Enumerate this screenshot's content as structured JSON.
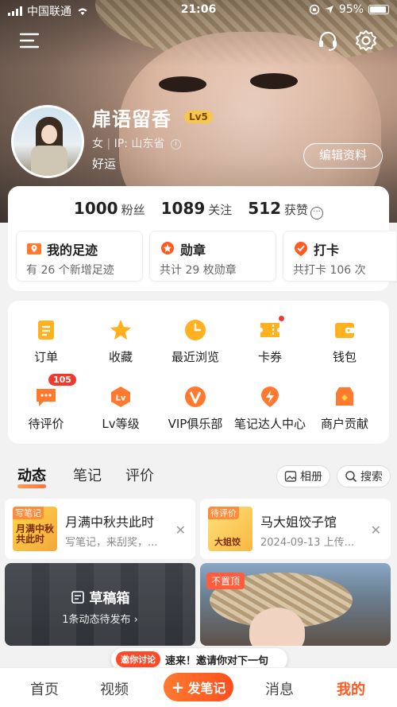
{
  "status_bar": {
    "carrier": "中国联通",
    "time": "21:06",
    "battery": "95%"
  },
  "profile": {
    "name": "扉语留香",
    "level": "Lv5",
    "gender": "女",
    "ip": "IP: 山东省",
    "bio": "好运",
    "edit_label": "编辑资料"
  },
  "stats": [
    {
      "num": "1000",
      "label": "粉丝"
    },
    {
      "num": "1089",
      "label": "关注"
    },
    {
      "num": "512",
      "label": "获赞"
    }
  ],
  "mini_cards": [
    {
      "title": "我的足迹",
      "sub": "有 26 个新增足迹",
      "icon": "map-pin-icon",
      "color": "#ff7a2f"
    },
    {
      "title": "勋章",
      "sub": "共计 29 枚勋章",
      "icon": "medal-icon",
      "color": "#ff5a1f"
    },
    {
      "title": "打卡",
      "sub": "共打卡 106 次",
      "icon": "checkin-icon",
      "color": "#ff5a1f"
    }
  ],
  "grid": [
    {
      "label": "订单",
      "icon": "order-icon"
    },
    {
      "label": "收藏",
      "icon": "star-icon"
    },
    {
      "label": "最近浏览",
      "icon": "clock-icon"
    },
    {
      "label": "卡券",
      "icon": "ticket-icon"
    },
    {
      "label": "钱包",
      "icon": "wallet-icon"
    },
    {
      "label": "待评价",
      "icon": "comment-icon",
      "badge": "105"
    },
    {
      "label": "Lv等级",
      "icon": "level-icon"
    },
    {
      "label": "VIP俱乐部",
      "icon": "vip-icon"
    },
    {
      "label": "笔记达人中心",
      "icon": "lightning-icon"
    },
    {
      "label": "商户贡献",
      "icon": "shop-icon"
    }
  ],
  "tabs": [
    "动态",
    "笔记",
    "评价"
  ],
  "tab_buttons": {
    "album": "相册",
    "search": "搜索"
  },
  "feed_cards": [
    {
      "tag": "写笔记",
      "thumb_text": "月满中秋共此时",
      "title": "月满中秋共此时",
      "sub": "写笔记，来刮奖，..."
    },
    {
      "tag": "待评价",
      "thumb_text": "大姐饺",
      "title": "马大姐饺子馆",
      "sub": "2024-09-13 上传..."
    }
  ],
  "drafts": {
    "title": "草稿箱",
    "sub": "1条动态待发布"
  },
  "photo_card": {
    "pin": "不置顶"
  },
  "promo": {
    "chip": "邀你讨论",
    "text": "速来！邀请你对下一句"
  },
  "nav": {
    "home": "首页",
    "video": "视频",
    "post": "发笔记",
    "messages": "消息",
    "me": "我的"
  },
  "accent": "#ff5a1f"
}
